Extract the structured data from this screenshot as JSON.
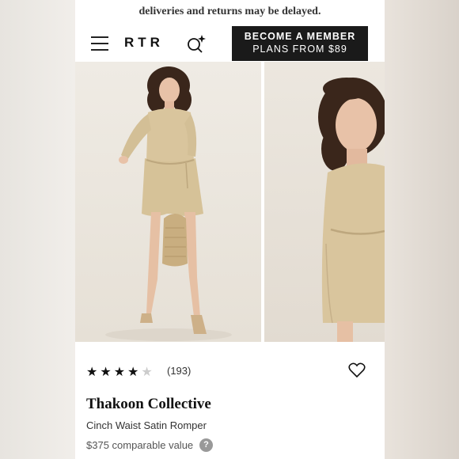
{
  "banner": {
    "text": "deliveries and returns may be delayed."
  },
  "header": {
    "logo": "RTR",
    "cta_line1": "BECOME A MEMBER",
    "cta_line2": "PLANS FROM $89",
    "icons": [
      "hamburger-menu-icon",
      "search-sparkle-icon"
    ]
  },
  "product": {
    "rating": 4,
    "rating_max": 5,
    "review_count": "(193)",
    "brand": "Thakoon Collective",
    "name": "Cinch Waist Satin Romper",
    "comparable_value": "$375 comparable value",
    "help_icon": "?",
    "favorite_icon": "heart-icon"
  },
  "colors": {
    "cta_bg": "#1a1a1a",
    "romper": "#d8c49c",
    "backdrop": "#ece8e3"
  }
}
